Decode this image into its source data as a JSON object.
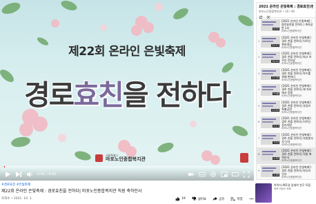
{
  "video": {
    "episode_title": "제22회 온라인 은빛축제",
    "headline_a": "경로",
    "headline_b": "효친",
    "headline_c": "을 전하다",
    "org_sub": "서울특별시",
    "org_name": "마포노인종합복지관",
    "current_time": "0:01 / 4:55",
    "progress_fraction": 0.004
  },
  "info": {
    "hashtags": "#경로효친 #은빛축제",
    "title": "제22회 온라인 은빛축제 : 경로효친을 전하다| 마포노인종합복지관 직원 축하인사",
    "meta": "조회수 • 2021. 10. 1.",
    "like_count": "19",
    "dislike_label": "싫어요",
    "share_label": "공유",
    "save_label": "저장"
  },
  "playlist": {
    "title": "2021 온라인 은빛축제 : 경로효친(편지회)를 위해",
    "subtitle": "마포노인종합복지관 • 10 / 40",
    "items": [
      {
        "idx": "",
        "title": "[2021 온라인 은빛축제] : 경로효친을 전하다 | 축하공연 1부",
        "channel": "마포노인종합복지관",
        "duration": "4:55"
      },
      {
        "idx": "1",
        "title": "[2021 온라인 은빛축제] : 경로 친을 전하다| 어르신 축하영상",
        "channel": "마포노인종합복지관",
        "duration": "22:17"
      },
      {
        "idx": "2",
        "title": "[2021 온라인 은빛축제] : 경로 친을 전하다| 최고 어르신 인터뷰",
        "channel": "마포노인종합복지관",
        "duration": "16:41"
      },
      {
        "idx": "3",
        "title": "[2021 온라인 은빛축제] : 경로 친을 전하다| 박수를 위해 한마디",
        "channel": "마포노인종합복지관",
        "duration": "11:35"
      },
      {
        "idx": "4",
        "title": "[2021 온라인 은빛축제] : 경로 친을 전하다| 제 자리에서 응원",
        "channel": "마포노인종합복지관",
        "duration": "9:48"
      },
      {
        "idx": "5",
        "title": "[2021 온라인 은빛축제] : 경로 친을 전하다| 유튜브 특별공연",
        "channel": "마포노인종합복지관",
        "duration": "13:52"
      },
      {
        "idx": "6",
        "title": "[2021 온라인 은빛축제] : 경로 친을 전하다| 어르신 장기자랑",
        "channel": "마포노인종합복지관",
        "duration": "5:11"
      },
      {
        "idx": "7",
        "title": "[2021 온라인 은빛축제] : 경로 친을 전하다| 자원봉사자 인사",
        "channel": "마포노인종합복지관",
        "duration": "3:12"
      },
      {
        "idx": "8",
        "title": "[2021 온라인 은빛축제] : 경로 친을 전하다| 직원 축하인사",
        "channel": "마포노인종합복지관",
        "duration": "4:55"
      },
      {
        "idx": "9",
        "title": "[2021 온라인 은빛축제] : 경로 친을 전하다| 마무리 인사",
        "channel": "마포노인종합복지관",
        "duration": "2:09"
      }
    ]
  },
  "recommendation": {
    "title": "아이사 461일 입대하 친구 모음",
    "channel": "마포 어르신 조회"
  }
}
